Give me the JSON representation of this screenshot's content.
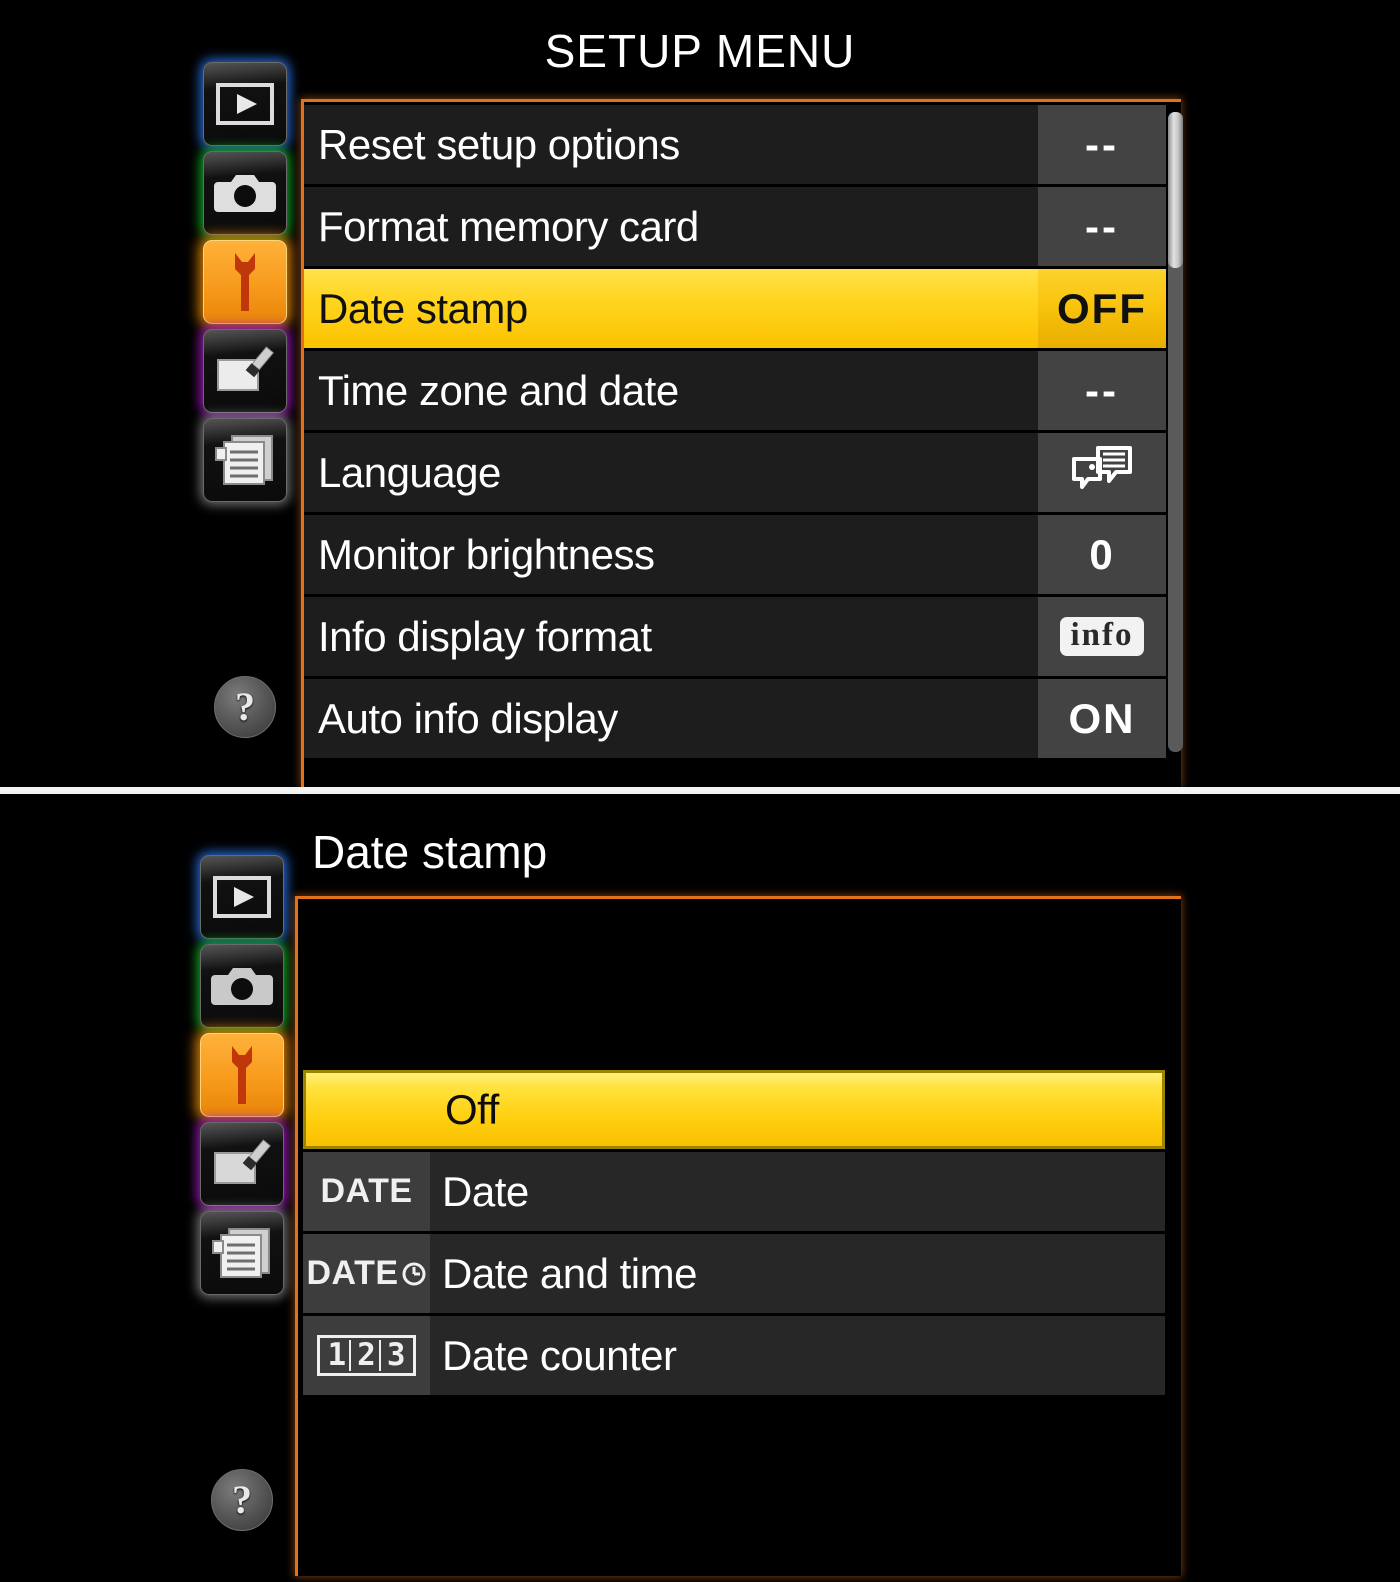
{
  "top_panel": {
    "title": "SETUP MENU",
    "sidebar": [
      {
        "name": "playback-menu",
        "icon": "playback-icon",
        "glow": "blue",
        "active": false
      },
      {
        "name": "shooting-menu",
        "icon": "camera-icon",
        "glow": "green",
        "active": false
      },
      {
        "name": "setup-menu",
        "icon": "wrench-icon",
        "glow": "orange",
        "active": true
      },
      {
        "name": "retouch-menu",
        "icon": "paintbrush-icon",
        "glow": "purple",
        "active": false
      },
      {
        "name": "recent-settings-menu",
        "icon": "documents-icon",
        "glow": "white",
        "active": false
      }
    ],
    "help_label": "?",
    "rows": [
      {
        "label": "Reset setup options",
        "value": "--",
        "value_type": "text",
        "selected": false
      },
      {
        "label": "Format memory card",
        "value": "--",
        "value_type": "text",
        "selected": false
      },
      {
        "label": "Date stamp",
        "value": "OFF",
        "value_type": "text",
        "selected": true
      },
      {
        "label": "Time zone and date",
        "value": "--",
        "value_type": "text",
        "selected": false
      },
      {
        "label": "Language",
        "value": "",
        "value_type": "language-icon",
        "selected": false
      },
      {
        "label": "Monitor brightness",
        "value": "0",
        "value_type": "text",
        "selected": false
      },
      {
        "label": "Info display format",
        "value": "info",
        "value_type": "info-badge",
        "selected": false
      },
      {
        "label": "Auto info display",
        "value": "ON",
        "value_type": "text",
        "selected": false
      }
    ]
  },
  "bottom_panel": {
    "title": "Date stamp",
    "sidebar": [
      {
        "name": "playback-menu",
        "icon": "playback-icon",
        "glow": "blue",
        "active": false
      },
      {
        "name": "shooting-menu",
        "icon": "camera-icon",
        "glow": "green",
        "active": false
      },
      {
        "name": "setup-menu",
        "icon": "wrench-icon",
        "glow": "orange",
        "active": true
      },
      {
        "name": "retouch-menu",
        "icon": "paintbrush-icon",
        "glow": "purple",
        "active": false
      },
      {
        "name": "recent-settings-menu",
        "icon": "documents-icon",
        "glow": "white",
        "active": false
      }
    ],
    "help_label": "?",
    "options": [
      {
        "label": "Off",
        "icon": "none",
        "icon_text": "",
        "selected": true
      },
      {
        "label": "Date",
        "icon": "date-icon",
        "icon_text": "DATE",
        "selected": false
      },
      {
        "label": "Date and time",
        "icon": "date-clock-icon",
        "icon_text": "DATE",
        "selected": false
      },
      {
        "label": "Date counter",
        "icon": "counter-icon",
        "icon_text": "123",
        "selected": false
      }
    ]
  },
  "colors": {
    "highlight_yellow": "#ffd520",
    "accent_orange": "#e2711d",
    "row_dark": "#1d1d1d",
    "value_gray": "#434343",
    "background": "#000000"
  }
}
